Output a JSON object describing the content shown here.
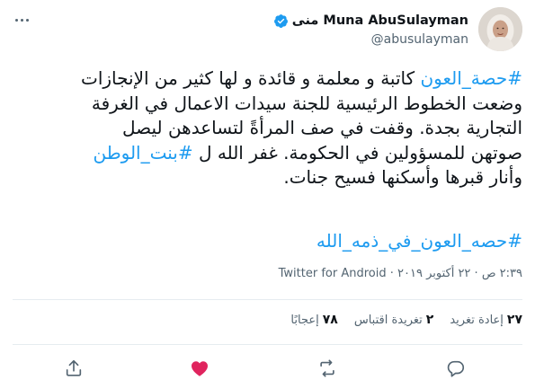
{
  "user": {
    "display_name": "Muna AbuSulayman منى",
    "handle": "@abusulayman",
    "verified": true,
    "avatar_icon": "user-avatar-photo"
  },
  "tweet": {
    "lines": [
      "#حصة_العون كاتبة و معلمة و قائدة و لها كثير من الإنجازات",
      "وضعت الخطوط الرئيسية للجنة سيدات الاعمال في الغرفة",
      "التجارية بجدة. وقفت في صف المرأةً لتساعدهن ليصل",
      "صوتهن للمسؤولين في الحكومة.  غفر الله ل #بنت_الوطن",
      "وأنار قبرها وأسكنها فسيح جنات."
    ],
    "hashtag_line": "#حصه_العون_في_ذمه_الله"
  },
  "meta": {
    "timestamp": "٢:٣٩ ص · ٢٢ أكتوبر ٢٠١٩ · Twitter for Android"
  },
  "stats": {
    "retweets_count": "٢٧",
    "retweets_label": "إعادة تغريد",
    "quotes_count": "٢",
    "quotes_label": "تغريدة اقتباس",
    "likes_count": "٧٨",
    "likes_label": "إعجابًا"
  },
  "colors": {
    "accent": "#1d9bf0",
    "like": "#e0245e",
    "muted": "#536471",
    "text": "#0f1419",
    "border": "#e6ecf0"
  }
}
